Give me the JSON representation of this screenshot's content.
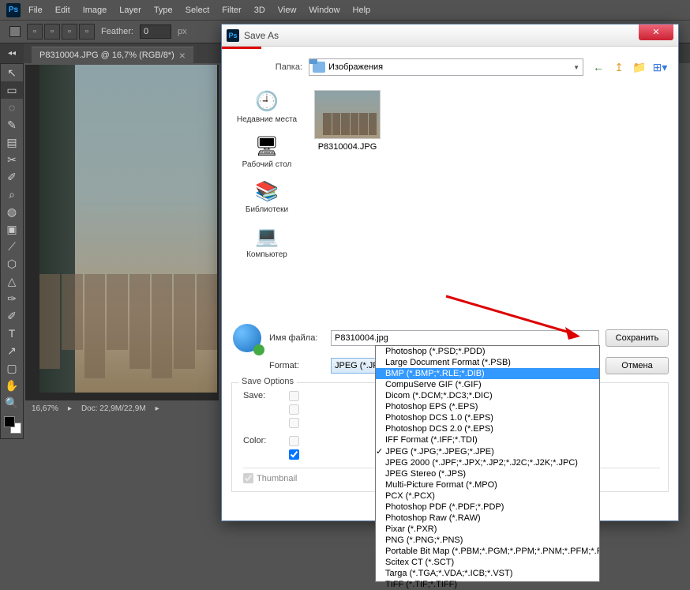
{
  "menubar": [
    "File",
    "Edit",
    "Image",
    "Layer",
    "Type",
    "Select",
    "Filter",
    "3D",
    "View",
    "Window",
    "Help"
  ],
  "options": {
    "feather_label": "Feather:",
    "feather_value": "0",
    "feather_unit": "px"
  },
  "tab": {
    "title": "P8310004.JPG @ 16,7% (RGB/8*)"
  },
  "status": {
    "zoom": "16,67%",
    "doc": "Doc: 22,9M/22,9M"
  },
  "tools": [
    "↖",
    "▭",
    "◌",
    "✎",
    "▤",
    "✂",
    "✐",
    "⌕",
    "◍",
    "▣",
    "⟋",
    "⬡",
    "△",
    "✑",
    "✐",
    "T",
    "↗",
    "▢",
    "✋",
    "🔍"
  ],
  "dialog": {
    "title": "Save As",
    "folder_label": "Папка:",
    "folder_value": "Изображения",
    "places": [
      {
        "label": "Недавние места",
        "icon": "🕘"
      },
      {
        "label": "Рабочий стол",
        "icon": "🖥"
      },
      {
        "label": "Библиотеки",
        "icon": "📚"
      },
      {
        "label": "Компьютер",
        "icon": "💻"
      }
    ],
    "file_thumb_label": "P8310004.JPG",
    "filename_label": "Имя файла:",
    "filename_value": "P8310004.jpg",
    "format_label": "Format:",
    "format_value": "JPEG (*.JPG;*.JPEG;*.JPE)",
    "save_btn": "Сохранить",
    "cancel_btn": "Отмена",
    "save_options_title": "Save Options",
    "save_label": "Save:",
    "color_label": "Color:",
    "thumbnail_label": "Thumbnail",
    "format_list": [
      "Photoshop (*.PSD;*.PDD)",
      "Large Document Format (*.PSB)",
      "BMP (*.BMP;*.RLE;*.DIB)",
      "CompuServe GIF (*.GIF)",
      "Dicom (*.DCM;*.DC3;*.DIC)",
      "Photoshop EPS (*.EPS)",
      "Photoshop DCS 1.0 (*.EPS)",
      "Photoshop DCS 2.0 (*.EPS)",
      "IFF Format (*.IFF;*.TDI)",
      "JPEG (*.JPG;*.JPEG;*.JPE)",
      "JPEG 2000 (*.JPF;*.JPX;*.JP2;*.J2C;*.J2K;*.JPC)",
      "JPEG Stereo (*.JPS)",
      "Multi-Picture Format (*.MPO)",
      "PCX (*.PCX)",
      "Photoshop PDF (*.PDF;*.PDP)",
      "Photoshop Raw (*.RAW)",
      "Pixar (*.PXR)",
      "PNG (*.PNG;*.PNS)",
      "Portable Bit Map (*.PBM;*.PGM;*.PPM;*.PNM;*.PFM;*.PAM)",
      "Scitex CT (*.SCT)",
      "Targa (*.TGA;*.VDA;*.ICB;*.VST)",
      "TIFF (*.TIF;*.TIFF)"
    ],
    "format_highlight_index": 2,
    "format_checked_index": 9
  }
}
